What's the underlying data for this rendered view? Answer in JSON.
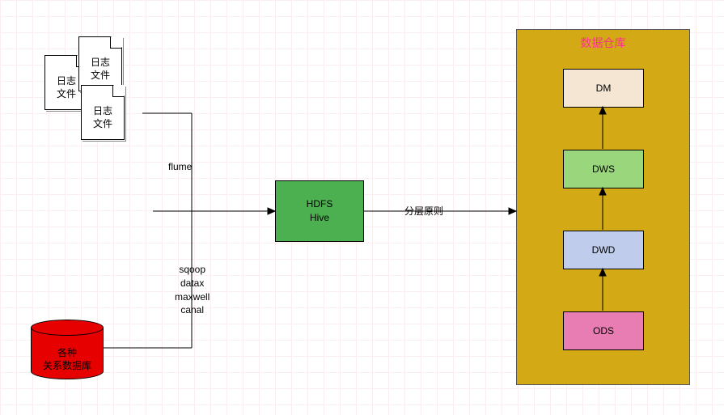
{
  "logFiles": {
    "label1": "日志\n文件",
    "label2": "日志\n文件",
    "label3": "日志\n文件"
  },
  "flume": "flume",
  "sqoop": "sqoop\ndatax\nmaxwell\ncanal",
  "db": "各种\n关系数据库",
  "hdfs": "HDFS\nHive",
  "layerRule": "分层原则",
  "warehouse": {
    "title": "数据仓库",
    "dm": "DM",
    "dws": "DWS",
    "dwd": "DWD",
    "ods": "ODS"
  },
  "chart_data": {
    "type": "diagram",
    "nodes": [
      {
        "id": "log-files",
        "label": "日志文件",
        "kind": "file-stack"
      },
      {
        "id": "rdbms",
        "label": "各种关系数据库",
        "kind": "cylinder"
      },
      {
        "id": "hdfs-hive",
        "label": "HDFS Hive",
        "kind": "process"
      },
      {
        "id": "warehouse",
        "label": "数据仓库",
        "kind": "container",
        "children": [
          "ODS",
          "DWD",
          "DWS",
          "DM"
        ]
      }
    ],
    "edges": [
      {
        "from": "log-files",
        "to": "hdfs-hive",
        "label": "flume"
      },
      {
        "from": "rdbms",
        "to": "hdfs-hive",
        "label": "sqoop / datax / maxwell / canal"
      },
      {
        "from": "hdfs-hive",
        "to": "warehouse",
        "label": "分层原则"
      },
      {
        "from": "ODS",
        "to": "DWD"
      },
      {
        "from": "DWD",
        "to": "DWS"
      },
      {
        "from": "DWS",
        "to": "DM"
      }
    ]
  }
}
